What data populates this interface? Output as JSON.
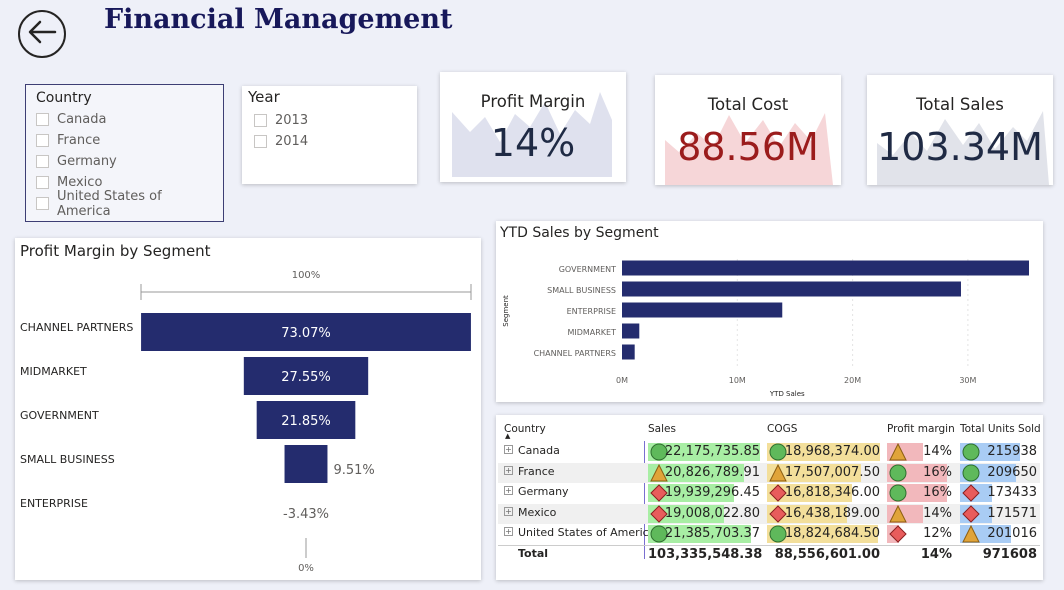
{
  "header": {
    "title": "Financial Management"
  },
  "country_slicer": {
    "title": "Country",
    "items": [
      "Canada",
      "France",
      "Germany",
      "Mexico",
      "United States of America"
    ]
  },
  "year_slicer": {
    "title": "Year",
    "items": [
      "2013",
      "2014"
    ]
  },
  "kpis": {
    "profit_margin": {
      "label": "Profit Margin",
      "value": "14%"
    },
    "total_cost": {
      "label": "Total Cost",
      "value": "88.56M"
    },
    "total_sales": {
      "label": "Total Sales",
      "value": "103.34M"
    }
  },
  "colors": {
    "navy": "#242c6e",
    "kpi_red": "#9b1c1c",
    "kpi_dark": "#1f2a44",
    "green_bg": "#a8eea4",
    "orange_bg": "#f3df9b",
    "red_bg": "#f2b8bc",
    "blue_bg": "#a9ccf4"
  },
  "chart_data": [
    {
      "type": "bar",
      "title": "Profit Margin by Segment",
      "categories": [
        "CHANNEL PARTNERS",
        "MIDMARKET",
        "GOVERNMENT",
        "SMALL BUSINESS",
        "ENTERPRISE"
      ],
      "values": [
        73.07,
        27.55,
        21.85,
        9.51,
        -3.43
      ],
      "data_labels": [
        "73.07%",
        "27.55%",
        "21.85%",
        "9.51%",
        "-3.43%"
      ],
      "axis_top_label": "100%",
      "axis_bottom_label": "0%",
      "ylim": [
        0,
        100
      ]
    },
    {
      "type": "bar",
      "title": "YTD Sales by Segment",
      "categories": [
        "GOVERNMENT",
        "SMALL BUSINESS",
        "ENTERPRISE",
        "MIDMARKET",
        "CHANNEL PARTNERS"
      ],
      "values": [
        35.3,
        29.4,
        13.9,
        1.5,
        1.1
      ],
      "xlabel": "YTD Sales",
      "ylabel": "Segment",
      "xticks": [
        "0M",
        "10M",
        "20M",
        "30M"
      ],
      "xlim": [
        0,
        35.3
      ],
      "grid": true
    }
  ],
  "table": {
    "headers": [
      "Country",
      "Sales",
      "COGS",
      "Profit margin",
      "Total Units Sold"
    ],
    "rows": [
      {
        "country": "Canada",
        "sales": "22,175,735.85",
        "sales_icon": "circle",
        "cogs": "18,968,374.00",
        "cogs_icon": "circle",
        "margin": "14%",
        "margin_icon": "triangle",
        "units": "215938",
        "units_icon": "circle",
        "sales_pct": 1.0,
        "cogs_pct": 1.0,
        "margin_pct": 0.55,
        "units_pct": 0.78
      },
      {
        "country": "France",
        "sales": "20,826,789.91",
        "sales_icon": "triangle",
        "cogs": "17,507,007.50",
        "cogs_icon": "triangle",
        "margin": "16%",
        "margin_icon": "circle",
        "units": "209650",
        "units_icon": "circle",
        "sales_pct": 0.86,
        "cogs_pct": 0.83,
        "margin_pct": 0.93,
        "units_pct": 0.73
      },
      {
        "country": "Germany",
        "sales": "19,939,296.45",
        "sales_icon": "diamond",
        "cogs": "16,818,346.00",
        "cogs_icon": "diamond",
        "margin": "16%",
        "margin_icon": "circle",
        "units": "173433",
        "units_icon": "diamond",
        "sales_pct": 0.77,
        "cogs_pct": 0.75,
        "margin_pct": 0.93,
        "units_pct": 0.42
      },
      {
        "country": "Mexico",
        "sales": "19,008,022.80",
        "sales_icon": "diamond",
        "cogs": "16,438,189.00",
        "cogs_icon": "diamond",
        "margin": "14%",
        "margin_icon": "triangle",
        "units": "171571",
        "units_icon": "diamond",
        "sales_pct": 0.68,
        "cogs_pct": 0.71,
        "margin_pct": 0.55,
        "units_pct": 0.41
      },
      {
        "country": "United States of America",
        "sales": "21,385,703.37",
        "sales_icon": "circle",
        "cogs": "18,824,684.50",
        "cogs_icon": "circle",
        "margin": "12%",
        "margin_icon": "diamond",
        "units": "201016",
        "units_icon": "triangle",
        "sales_pct": 0.92,
        "cogs_pct": 0.98,
        "margin_pct": 0.18,
        "units_pct": 0.66
      }
    ],
    "total": {
      "label": "Total",
      "sales": "103,335,548.38",
      "cogs": "88,556,601.00",
      "margin": "14%",
      "units": "971608"
    }
  }
}
